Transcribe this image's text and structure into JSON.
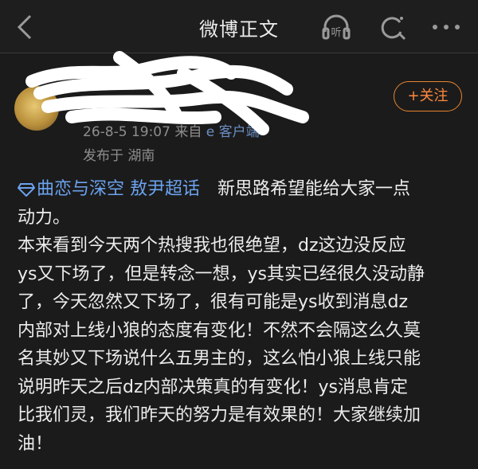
{
  "topbar": {
    "title": "微博正文",
    "listen_label": "听"
  },
  "author": {
    "name": "",
    "meta_time": "26-8-5 19:07",
    "meta_from": "来自",
    "meta_client": "e 客户端",
    "location": "发布于 湖南"
  },
  "follow_label": "+关注",
  "post": {
    "topic": "曲恋与深空 敖尹超话",
    "first_line": "新思路希望能给大家一点",
    "lines": [
      "动力。",
      "本来看到今天两个热搜我也很绝望，dz这边没反应",
      "ys又下场了，但是转念一想，ys其实已经很久没动静",
      "了，今天忽然又下场了，很有可能是ys收到消息dz",
      "内部对上线小狼的态度有变化！不然不会隔这么久莫",
      "名其妙又下场说什么五男主的，这么怕小狼上线只能",
      "说明昨天之后dz内部决策真的有变化！ys消息肯定",
      "比我们灵，我们昨天的努力是有效果的！大家继续加",
      "油！"
    ]
  },
  "colors": {
    "accent": "#ff8a3d",
    "link": "#6ba2ee",
    "background": "#1b1b1b"
  }
}
